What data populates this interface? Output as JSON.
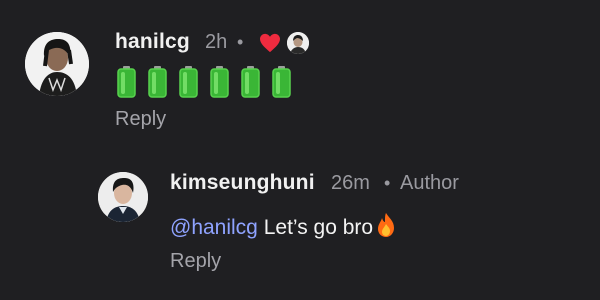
{
  "comments": [
    {
      "username": "hanilcg",
      "time": "2h",
      "separator": "•",
      "liked_by_author": true,
      "content_icons": [
        "battery-icon",
        "battery-icon",
        "battery-icon",
        "battery-icon",
        "battery-icon",
        "battery-icon"
      ],
      "reply_label": "Reply"
    },
    {
      "username": "kimseunghuni",
      "time": "26m",
      "separator": "•",
      "author_label": "Author",
      "mention": "@hanilcg",
      "text": " Let’s go bro",
      "emoji_icon": "fire-icon",
      "reply_label": "Reply"
    }
  ],
  "colors": {
    "background": "#1f1f22",
    "mention": "#8fa3ff",
    "heart": "#ee2b3f",
    "battery_green": "#43c53b",
    "meta": "#9a9aa0"
  }
}
